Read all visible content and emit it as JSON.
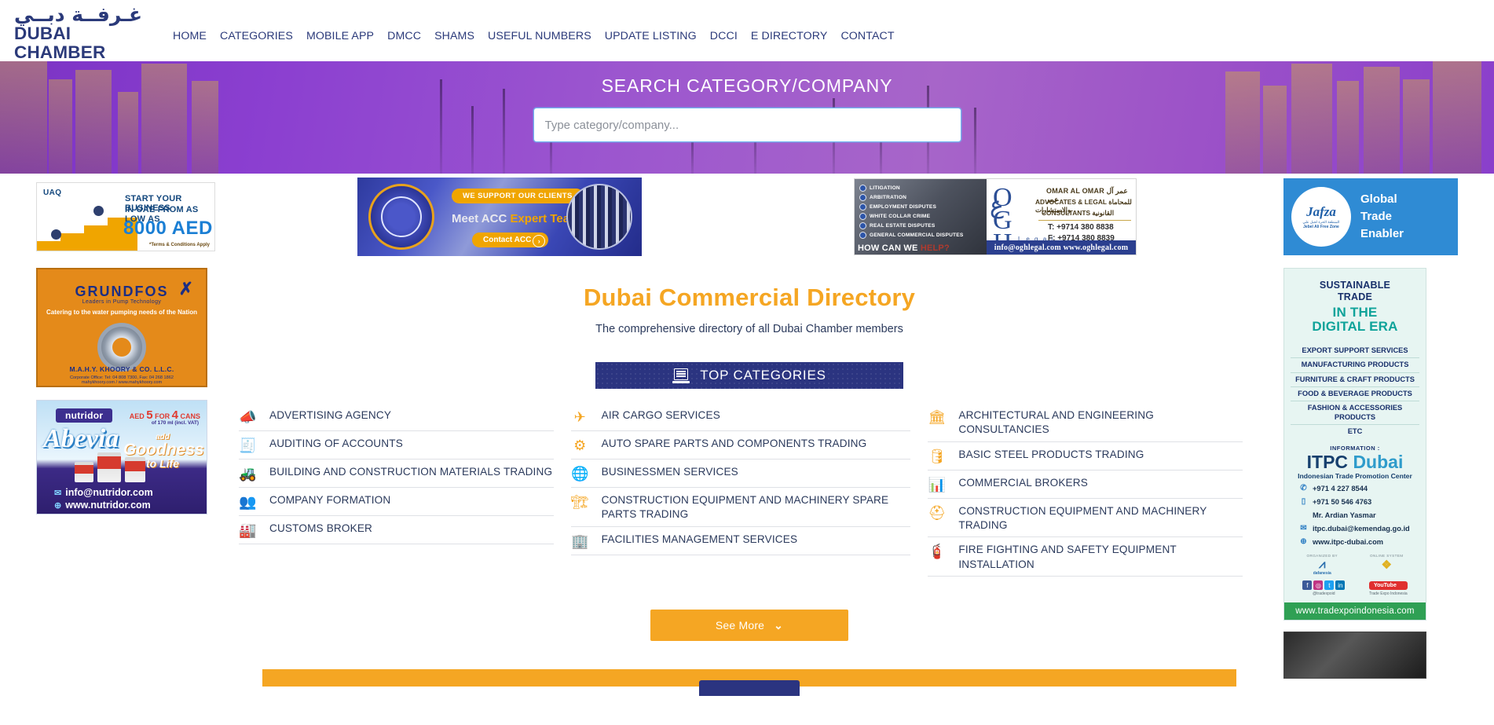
{
  "header": {
    "logo": {
      "arabic": "غـرفــة دبــي",
      "english": "DUBAI CHAMBER",
      "tagline": "Dubai Commercial Directory"
    },
    "nav": [
      {
        "label": "HOME",
        "name": "nav-home"
      },
      {
        "label": "CATEGORIES",
        "name": "nav-categories"
      },
      {
        "label": "MOBILE APP",
        "name": "nav-mobile-app"
      },
      {
        "label": "DMCC",
        "name": "nav-dmcc"
      },
      {
        "label": "SHAMS",
        "name": "nav-shams"
      },
      {
        "label": "USEFUL NUMBERS",
        "name": "nav-useful-numbers"
      },
      {
        "label": "UPDATE LISTING",
        "name": "nav-update-listing"
      },
      {
        "label": "DCCI",
        "name": "nav-dcci"
      },
      {
        "label": "E DIRECTORY",
        "name": "nav-e-directory"
      },
      {
        "label": "CONTACT",
        "name": "nav-contact"
      }
    ]
  },
  "hero": {
    "title": "SEARCH CATEGORY/COMPANY",
    "search_placeholder": "Type category/company...",
    "search_value": ""
  },
  "ads": {
    "uaq": {
      "logo": "UAQ",
      "line1": "START YOUR BUSINESS",
      "line2": "IN UAE FROM AS LOW AS",
      "amount": "8000 AED",
      "terms": "*Terms & Conditions Apply"
    },
    "acc": {
      "pill": "WE SUPPORT OUR CLIENTS",
      "headline_prefix": "Meet ACC ",
      "headline_highlight": "Expert Team!",
      "button": "Contact ACC",
      "arrow": "›"
    },
    "ogh": {
      "bullets": [
        "LITIGATION",
        "ARBITRATION",
        "EMPLOYMENT DISPUTES",
        "WHITE COLLAR CRIME",
        "REAL ESTATE DISPUTES",
        "GENERAL COMMERCIAL DISPUTES"
      ],
      "help": "HOW CAN WE ",
      "help_highlight": "HELP?",
      "monogram": "OGH",
      "legal_word": "L e g a l",
      "name_en": "OMAR AL OMAR",
      "name_ar": "عمر آل عمر",
      "line2_en": "ADVOCATES & LEGAL",
      "line2_ar": "للمحاماة والاستشارات",
      "line3_en": "CONSULTANTS",
      "line3_ar": "القانونية",
      "tel": "T: +9714 380 8838",
      "fax": "F: +9714 380 8839",
      "footer": "info@oghlegal.com  www.oghlegal.com"
    },
    "jafza": {
      "brand": "Jafza",
      "sub1": "المنطقة الحرة لجبل علي",
      "sub2": "Jebel Ali Free Zone",
      "text": "Global Trade Enabler"
    },
    "grundfos": {
      "brand": "GRUNDFOS",
      "tagline": "Leaders in Pump Technology",
      "line": "Catering to the water pumping needs of the Nation",
      "company": "M.A.H.Y. KHOORY & CO. L.L.C.",
      "address": "Corporate Office: Tel: 04 808 7300, Fax: 04 268 1862",
      "web": "mahykhoory.com / www.mahykhoory.com"
    },
    "nutridor": {
      "brand": "nutridor",
      "product": "Abevia",
      "offer_prefix": "AED",
      "offer_num1": "5",
      "offer_mid": "FOR",
      "offer_num2": "4",
      "offer_suffix": "CANS",
      "offer_note": "of 170 ml (incl. VAT)",
      "good1": "add",
      "good2": "Goodness",
      "good3": "to Life",
      "email": "info@nutridor.com",
      "web": "www.nutridor.com"
    },
    "itpc": {
      "h1_line1": "SUSTAINABLE",
      "h1_line2": "TRADE",
      "h2_line1": "IN THE",
      "h2_line2": "DIGITAL ERA",
      "items": [
        "EXPORT SUPPORT SERVICES",
        "MANUFACTURING PRODUCTS",
        "FURNITURE & CRAFT PRODUCTS",
        "FOOD & BEVERAGE PRODUCTS",
        "FASHION & ACCESSORIES PRODUCTS",
        "ETC"
      ],
      "info_label": "INFORMATION :",
      "brand1": "ITPC",
      "brand2": "Dubai",
      "brand_sub": "Indonesian Trade Promotion Center",
      "contacts": [
        {
          "icon": "phone-icon",
          "glyph": "✆",
          "text": "+971 4 227 8544"
        },
        {
          "icon": "mobile-icon",
          "glyph": "▯",
          "text": "+971 50 546 4763"
        },
        {
          "icon": "person-icon",
          "glyph": "",
          "text": "Mr. Ardian Yasmar"
        },
        {
          "icon": "email-icon",
          "glyph": "✉",
          "text": "itpc.dubai@kemendag.go.id"
        },
        {
          "icon": "globe-icon",
          "glyph": "⊕",
          "text": "www.itpc-dubai.com"
        }
      ],
      "org_left_label": "ORGANIZED BY",
      "org_left_name": "dafanesia",
      "org_right_label": "ONLINE SYSTEM",
      "org_right_name": "Trade Expo Indonesia",
      "social_handle": "@tradexpoid",
      "youtube": "YouTube",
      "youtube_sub": "Trade Expo Indonesia",
      "url": "www.tradexpoindonesia.com"
    }
  },
  "main": {
    "title": "Dubai Commercial Directory",
    "subtitle": "The comprehensive directory of all Dubai Chamber members",
    "top_categories_label": "TOP CATEGORIES",
    "see_more_label": "See More",
    "see_more_chevron": "⌄",
    "columns": [
      [
        {
          "label": "ADVERTISING AGENCY",
          "icon": "megaphone-icon",
          "glyph": "📣"
        },
        {
          "label": "AUDITING OF ACCOUNTS",
          "icon": "clipboard-calculator-icon",
          "glyph": "🧾"
        },
        {
          "label": "BUILDING AND CONSTRUCTION MATERIALS TRADING",
          "icon": "excavator-icon",
          "glyph": "🚜"
        },
        {
          "label": "COMPANY FORMATION",
          "icon": "people-group-icon",
          "glyph": "👥"
        },
        {
          "label": "CUSTOMS BROKER",
          "icon": "customs-icon",
          "glyph": "🏭"
        }
      ],
      [
        {
          "label": "AIR CARGO SERVICES",
          "icon": "airplane-icon",
          "glyph": "✈"
        },
        {
          "label": "AUTO SPARE PARTS AND COMPONENTS TRADING",
          "icon": "gears-icon",
          "glyph": "⚙"
        },
        {
          "label": "BUSINESSMEN SERVICES",
          "icon": "globe-person-icon",
          "glyph": "🌐"
        },
        {
          "label": "CONSTRUCTION EQUIPMENT AND MACHINERY SPARE PARTS TRADING",
          "icon": "crane-icon",
          "glyph": "🏗"
        },
        {
          "label": "FACILITIES MANAGEMENT SERVICES",
          "icon": "factory-icon",
          "glyph": "🏢"
        }
      ],
      [
        {
          "label": "ARCHITECTURAL AND ENGINEERING CONSULTANCIES",
          "icon": "building-hand-icon",
          "glyph": "🏛"
        },
        {
          "label": "BASIC STEEL PRODUCTS TRADING",
          "icon": "steel-coils-icon",
          "glyph": "🛢"
        },
        {
          "label": "COMMERCIAL BROKERS",
          "icon": "broker-chart-icon",
          "glyph": "📊"
        },
        {
          "label": "CONSTRUCTION EQUIPMENT AND MACHINERY TRADING",
          "icon": "hardhat-gear-icon",
          "glyph": "⛑"
        },
        {
          "label": "FIRE FIGHTING AND SAFETY EQUIPMENT INSTALLATION",
          "icon": "fire-safety-icon",
          "glyph": "🧯"
        }
      ]
    ]
  },
  "colors": {
    "brand_navy": "#2b3a7a",
    "accent_orange": "#f5a623",
    "hero_purple": "#9b55cf",
    "topcat_navy": "#2b3480"
  }
}
